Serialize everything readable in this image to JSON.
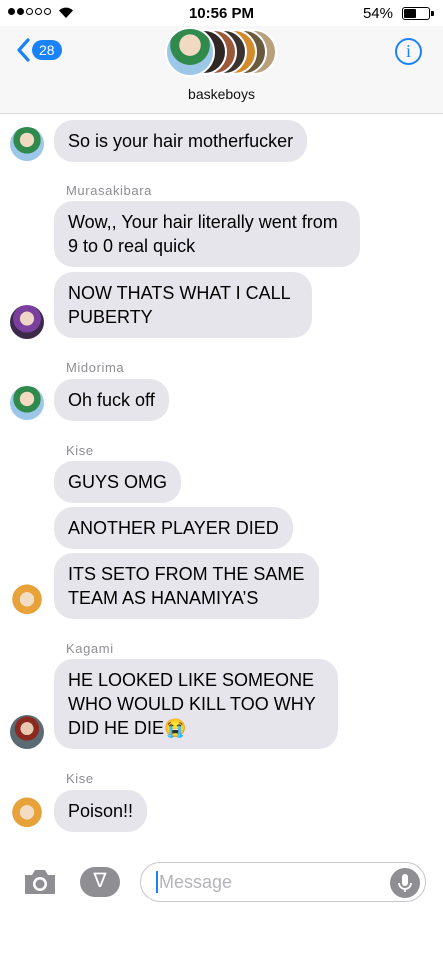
{
  "status": {
    "time": "10:56 PM",
    "battery": "54%",
    "battery_level": 0.54
  },
  "header": {
    "back_count": "28",
    "group_name": "baskeboys",
    "info_label": "i"
  },
  "messages": {
    "m1": "So is your hair motherfucker",
    "s2": "Murasakibara",
    "m2": "Wow,, Your hair literally went from 9 to 0 real quick",
    "m3": "NOW THATS WHAT I CALL PUBERTY",
    "s4": "Midorima",
    "m4": "Oh fuck off",
    "s5": "Kise",
    "m5": "GUYS OMG",
    "m6": "ANOTHER PLAYER DIED",
    "m7": "ITS SETO FROM THE SAME TEAM AS HANAMIYA’S",
    "s8": "Kagami",
    "m8": "HE LOOKED LIKE SOMEONE WHO WOULD KILL TOO WHY DID HE DIE😭",
    "s9": "Kise",
    "m9": "Poison!!"
  },
  "input": {
    "placeholder": "Message"
  },
  "colors": {
    "accent": "#1a82fb",
    "bubble": "#e6e5eb",
    "sender": "#8e8e93"
  }
}
